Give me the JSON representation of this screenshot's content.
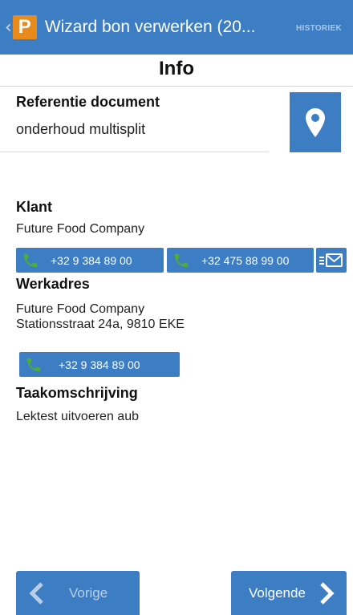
{
  "appbar": {
    "title": "Wizard bon verwerken (20...",
    "history_label": "HISTORIEK",
    "logo_letter": "P"
  },
  "page": {
    "title": "Info"
  },
  "reference": {
    "label": "Referentie document",
    "value": "onderhoud multisplit"
  },
  "client": {
    "label": "Klant",
    "name": "Future Food Company",
    "phone1": "+32 9 384 89 00",
    "phone2": "+32 475 88 99 00"
  },
  "workaddress": {
    "label": "Werkadres",
    "line1": "Future Food Company",
    "line2": "Stationsstraat 24a, 9810 EKE",
    "phone": "+32 9 384 89 00"
  },
  "task": {
    "label": "Taakomschrijving",
    "value": "Lektest uitvoeren aub"
  },
  "nav": {
    "prev_label": "Vorige",
    "next_label": "Volgende"
  },
  "colors": {
    "primary": "#3d7dc4",
    "logo": "#e98a1c",
    "phone_icon": "#4caf3a"
  }
}
